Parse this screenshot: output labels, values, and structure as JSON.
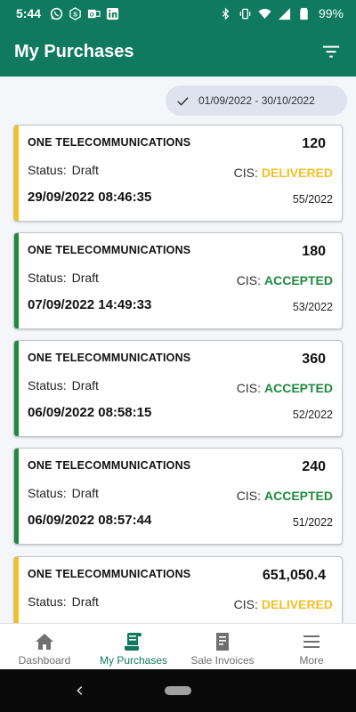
{
  "status_bar": {
    "time": "5:44",
    "battery": "99%",
    "notification_icons": [
      "whatsapp-icon",
      "s-app-icon",
      "outlook-icon",
      "linkedin-icon"
    ],
    "system_icons": [
      "bluetooth-icon",
      "vibrate-icon",
      "wifi-icon",
      "signal-icon",
      "battery-icon"
    ]
  },
  "app_bar": {
    "title": "My Purchases",
    "filter_icon": "filter-icon"
  },
  "date_filter": {
    "label": "01/09/2022 - 30/10/2022",
    "icon": "check-icon"
  },
  "purchases": [
    {
      "company": "ONE TELECOMMUNICATIONS",
      "amount": "120",
      "status_label": "Status:",
      "status": "Draft",
      "cis_label": "CIS:",
      "cis": "DELIVERED",
      "datetime": "29/09/2022 08:46:35",
      "number": "55/2022"
    },
    {
      "company": "ONE TELECOMMUNICATIONS",
      "amount": "180",
      "status_label": "Status:",
      "status": "Draft",
      "cis_label": "CIS:",
      "cis": "ACCEPTED",
      "datetime": "07/09/2022 14:49:33",
      "number": "53/2022"
    },
    {
      "company": "ONE TELECOMMUNICATIONS",
      "amount": "360",
      "status_label": "Status:",
      "status": "Draft",
      "cis_label": "CIS:",
      "cis": "ACCEPTED",
      "datetime": "06/09/2022 08:58:15",
      "number": "52/2022"
    },
    {
      "company": "ONE TELECOMMUNICATIONS",
      "amount": "240",
      "status_label": "Status:",
      "status": "Draft",
      "cis_label": "CIS:",
      "cis": "ACCEPTED",
      "datetime": "06/09/2022 08:57:44",
      "number": "51/2022"
    },
    {
      "company": "ONE TELECOMMUNICATIONS",
      "amount": "651,050.4",
      "status_label": "Status:",
      "status": "Draft",
      "cis_label": "CIS:",
      "cis": "DELIVERED",
      "datetime": "",
      "number": ""
    }
  ],
  "bottom_nav": {
    "items": [
      {
        "label": "Dashboard",
        "icon": "home-icon",
        "active": false
      },
      {
        "label": "My Purchases",
        "icon": "purchases-icon",
        "active": true
      },
      {
        "label": "Sale Invoices",
        "icon": "invoice-icon",
        "active": false
      },
      {
        "label": "More",
        "icon": "menu-icon",
        "active": false
      }
    ]
  },
  "colors": {
    "primary": "#0f7a5f",
    "delivered": "#f4c020",
    "accepted": "#1e8a3e",
    "chip_bg": "#dde3ef"
  }
}
